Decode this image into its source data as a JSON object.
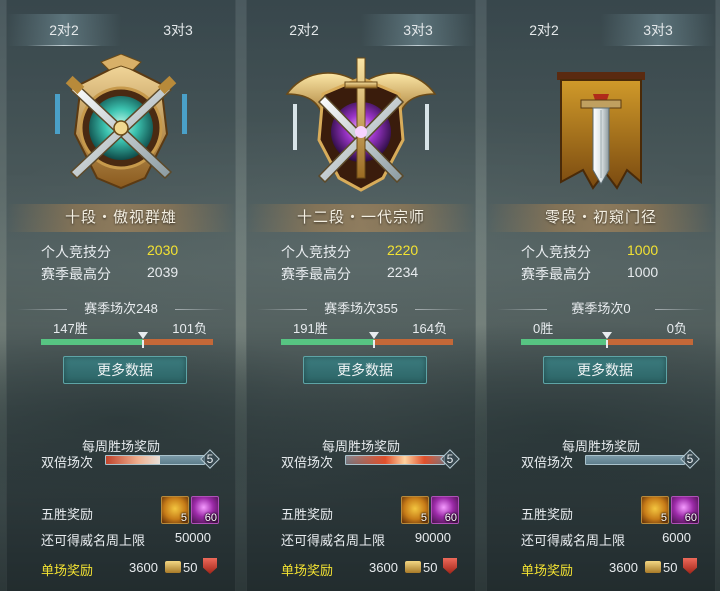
{
  "panels": [
    {
      "tabs": {
        "left": "2对2",
        "right": "3对3",
        "active": "left"
      },
      "rank_name": "十段・傲视群雄",
      "stats": {
        "personal_label": "个人竞技分",
        "personal_value": "2030",
        "season_high_label": "赛季最高分",
        "season_high_value": "2039"
      },
      "season": {
        "games_text": "赛季场次248",
        "wins": 147,
        "losses": 101,
        "wins_text": "147胜",
        "losses_text": "101负"
      },
      "more_button": "更多数据",
      "weekly": {
        "title": "每周胜场奖励",
        "double_label": "双倍场次",
        "double_count": "5",
        "progress": 0.55
      },
      "rewards": {
        "five_label": "五胜奖励",
        "item1_count": "5",
        "item2_count": "60",
        "limit_label": "还可得威名周上限",
        "limit_value": "50000",
        "single_label": "单场奖励",
        "single_coin": "3600",
        "single_badge": "50"
      }
    },
    {
      "tabs": {
        "left": "2对2",
        "right": "3对3",
        "active": "right"
      },
      "rank_name": "十二段・一代宗师",
      "stats": {
        "personal_label": "个人竞技分",
        "personal_value": "2220",
        "season_high_label": "赛季最高分",
        "season_high_value": "2234"
      },
      "season": {
        "games_text": "赛季场次355",
        "wins": 191,
        "losses": 164,
        "wins_text": "191胜",
        "losses_text": "164负"
      },
      "more_button": "更多数据",
      "weekly": {
        "title": "每周胜场奖励",
        "double_label": "双倍场次",
        "double_count": "5",
        "progress": 1.0
      },
      "rewards": {
        "five_label": "五胜奖励",
        "item1_count": "5",
        "item2_count": "60",
        "limit_label": "还可得威名周上限",
        "limit_value": "90000",
        "single_label": "单场奖励",
        "single_coin": "3600",
        "single_badge": "50"
      }
    },
    {
      "tabs": {
        "left": "2对2",
        "right": "3对3",
        "active": "right"
      },
      "rank_name": "零段・初窥门径",
      "stats": {
        "personal_label": "个人竞技分",
        "personal_value": "1000",
        "season_high_label": "赛季最高分",
        "season_high_value": "1000"
      },
      "season": {
        "games_text": "赛季场次0",
        "wins": 0,
        "losses": 0,
        "wins_text": "0胜",
        "losses_text": "0负"
      },
      "more_button": "更多数据",
      "weekly": {
        "title": "每周胜场奖励",
        "double_label": "双倍场次",
        "double_count": "5",
        "progress": 0.0
      },
      "rewards": {
        "five_label": "五胜奖励",
        "item1_count": "5",
        "item2_count": "60",
        "limit_label": "还可得威名周上限",
        "limit_value": "6000",
        "single_label": "单场奖励",
        "single_coin": "3600",
        "single_badge": "50"
      }
    }
  ],
  "colors": {
    "gold_text": "#f3e232",
    "win_bar": "#57c482",
    "loss_bar": "#c46838",
    "button": "#2c6466"
  },
  "icons": {
    "emblems": [
      "jade-crossed-swords-emblem-icon",
      "golden-winged-amethyst-emblem-icon",
      "banner-sword-emblem-icon"
    ],
    "item1": "gold-chest-icon",
    "item2": "purple-orb-icon",
    "coin": "coin-icon",
    "badge": "badge-icon"
  }
}
